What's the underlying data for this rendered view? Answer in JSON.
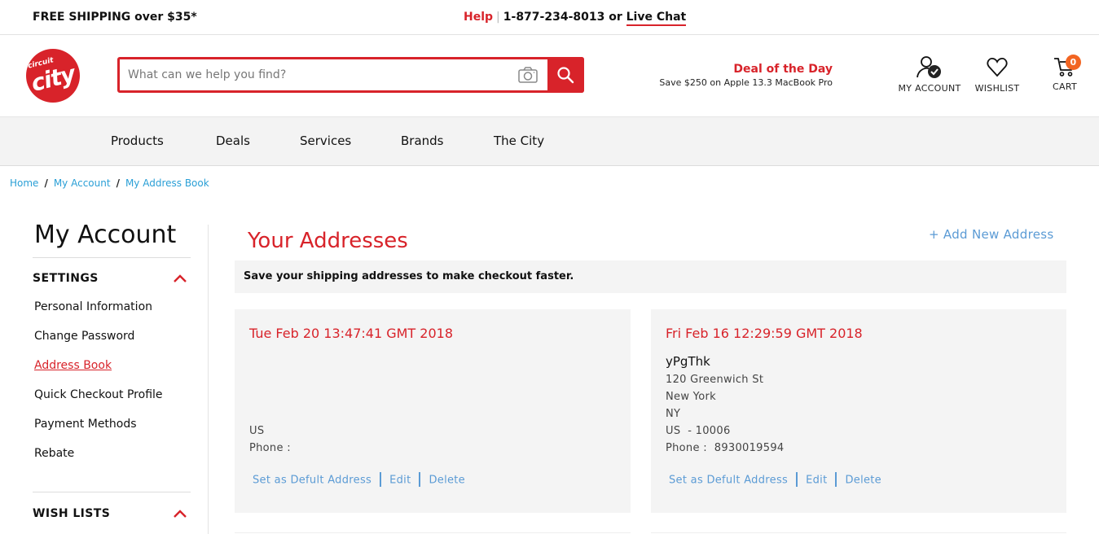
{
  "topbar": {
    "shipping": "FREE SHIPPING over $35*",
    "help": "Help",
    "separator": "|",
    "phone": "1-877-234-8013 or",
    "live_chat": "Live Chat"
  },
  "logo": {
    "line1": "circuit",
    "line2": "city"
  },
  "search": {
    "placeholder": "What can we help you find?"
  },
  "deal": {
    "title": "Deal of the Day",
    "subtitle": "Save $250 on Apple 13.3 MacBook Pro"
  },
  "header_icons": {
    "account": "MY ACCOUNT",
    "wishlist": "WISHLIST",
    "cart": "CART",
    "cart_count": "0"
  },
  "nav": {
    "items": [
      "Products",
      "Deals",
      "Services",
      "Brands",
      "The City"
    ]
  },
  "breadcrumb": {
    "items": [
      "Home",
      "My Account",
      "My Address Book"
    ]
  },
  "sidebar": {
    "title": "My Account",
    "settings_heading": "SETTINGS",
    "items": [
      "Personal Information",
      "Change Password",
      "Address Book",
      "Quick Checkout Profile",
      "Payment Methods",
      "Rebate"
    ],
    "active_item": "Address Book",
    "wishlists_heading": "WISH LISTS"
  },
  "main": {
    "title": "Your Addresses",
    "add_new": "+ Add New Address",
    "note": "Save your shipping addresses to make checkout faster.",
    "actions": {
      "set_default": "Set as Defult Address",
      "edit": "Edit",
      "delete": "Delete"
    },
    "cards": [
      {
        "date": "Tue Feb 20 13:47:41 GMT 2018",
        "name": "",
        "street": "",
        "city": "",
        "state": "",
        "country_zip": "US",
        "phone": "Phone :"
      },
      {
        "date": "Fri Feb 16 12:29:59 GMT 2018",
        "name": "yPgThk",
        "street": "120 Greenwich St",
        "city": "New York",
        "state": "NY",
        "country_zip": "US  - 10006",
        "phone": "Phone :  8930019594"
      }
    ]
  },
  "colors": {
    "brand_red": "#d8232a",
    "link_blue": "#5b9bd5",
    "breadcrumb_blue": "#2a9fd6",
    "badge_orange": "#f26522"
  }
}
